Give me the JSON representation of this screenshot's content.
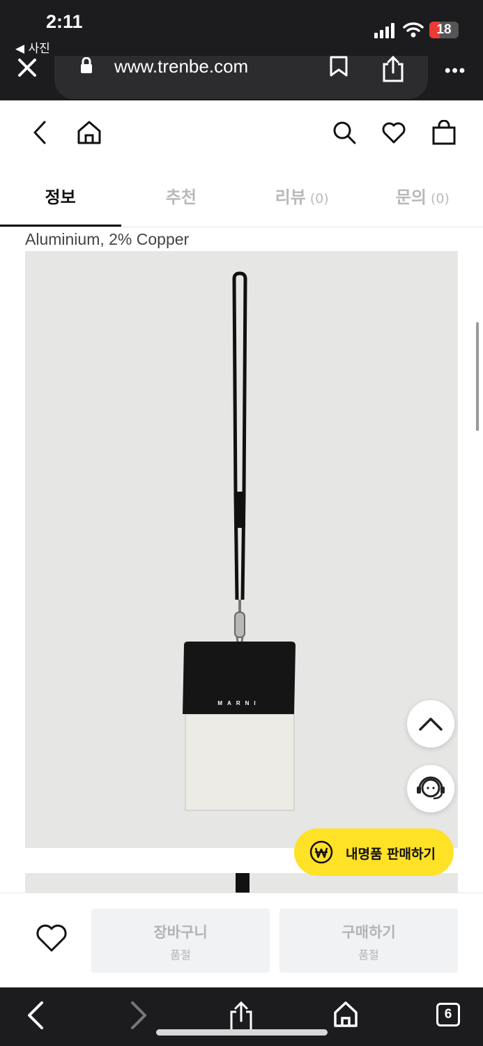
{
  "status_bar": {
    "time": "2:11",
    "back_app": "◀ 사진",
    "battery": "18"
  },
  "browser": {
    "url": "www.trenbe.com",
    "more": "•••",
    "tab_count": "6"
  },
  "tabs": [
    {
      "label": "정보",
      "count": ""
    },
    {
      "label": "추천",
      "count": ""
    },
    {
      "label": "리뷰",
      "count": "(0)"
    },
    {
      "label": "문의",
      "count": "(0)"
    }
  ],
  "product": {
    "material_text": "Aluminium, 2% Copper",
    "brand_on_bag": "MARNI"
  },
  "floating": {
    "sell_label": "내명품 판매하기"
  },
  "purchase": {
    "cart": {
      "label": "장바구니",
      "status": "품절"
    },
    "buy": {
      "label": "구매하기",
      "status": "품절"
    }
  },
  "colors": {
    "accent_yellow": "#ffe126",
    "browser_chrome": "#1c1c1e",
    "photo_bg": "#e6e6e5"
  }
}
